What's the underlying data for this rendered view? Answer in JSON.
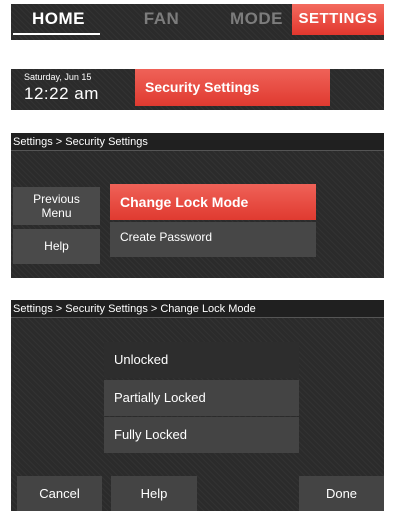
{
  "nav": {
    "tabs": [
      "HOME",
      "FAN",
      "MODE",
      "SETTINGS"
    ]
  },
  "header": {
    "date": "Saturday, Jun 15",
    "time": "12:22 am",
    "button": "Security Settings"
  },
  "security_panel": {
    "breadcrumb": "Settings > Security Settings",
    "side_buttons": [
      "Previous Menu",
      "Help"
    ],
    "options": [
      "Change Lock Mode",
      "Create Password"
    ]
  },
  "lock_mode_panel": {
    "breadcrumb": "Settings > Security Settings > Change Lock Mode",
    "options": [
      "Unlocked",
      "Partially Locked",
      "Fully Locked"
    ],
    "buttons": [
      "Cancel",
      "Help",
      "Done"
    ]
  },
  "colors": {
    "accent": "#e8463b",
    "panel_bg": "#2b2b2b",
    "button_bg": "#444444"
  }
}
